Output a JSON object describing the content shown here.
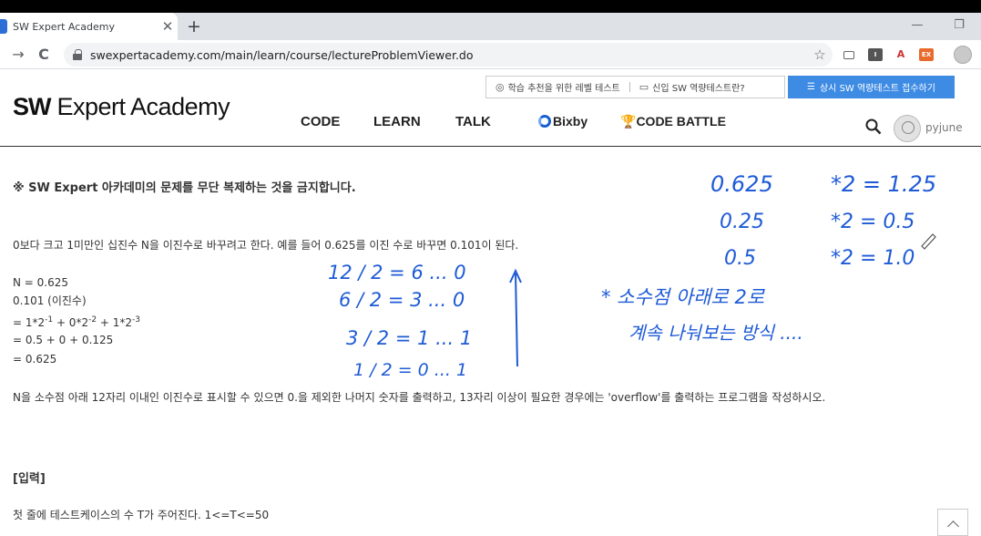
{
  "browser": {
    "tab_title": "SW Expert Academy",
    "tab_close": "✕",
    "new_tab": "+",
    "url": "swexpertacademy.com/main/learn/course/lectureProblemViewer.do",
    "minimize": "—",
    "restore": "❐",
    "back_icon": "→",
    "reload_icon": "C",
    "star_icon": "☆",
    "ext_pdf": "A",
    "ext_ex": "EX",
    "ext_i": "I"
  },
  "header": {
    "logo_bold": "SW",
    "logo_rest": " Expert Academy",
    "links": [
      {
        "label": "학습 추천을 위한 레벨 테스트",
        "icon": "check-circle-icon"
      },
      {
        "label": "신입 SW 역량테스트란?",
        "icon": "laptop-icon"
      }
    ],
    "apply_label": "상시 SW 역량테스트 접수하기",
    "menu": [
      "CODE",
      "LEARN",
      "TALK"
    ],
    "bixby": "Bixby",
    "code_battle": "CODE BATTLE",
    "username": "pyjune"
  },
  "content": {
    "notice": "※ SW Expert 아카데미의 문제를 무단 복제하는 것을 금지합니다.",
    "intro": "0보다 크고 1미만인 십진수 N을 이진수로 바꾸려고 한다. 예를 들어 0.625를 이진 수로 바꾸면 0.101이 된다.",
    "math": {
      "line1": "N = 0.625",
      "line2": "0.101 (이진수)",
      "line3_a": "= 1*2",
      "line3_e1": "-1",
      "line3_b": " + 0*2",
      "line3_e2": "-2",
      "line3_c": " + 1*2",
      "line3_e3": "-3",
      "line4": "= 0.5 + 0 + 0.125",
      "line5": "= 0.625"
    },
    "task": "N을 소수점 아래 12자리 이내인 이진수로 표시할 수 있으면 0.을 제외한 나머지 숫자를 출력하고, 13자리 이상이 필요한 경우에는 'overflow'를 출력하는 프로그램을 작성하시오.",
    "input_heading": "[입력]",
    "input_text": "첫 줄에 테스트케이스의 수 T가 주어진다. 1<=T<=50"
  },
  "handwriting": {
    "color": "#1f5bd6",
    "right_rows": [
      {
        "a": "0.625",
        "b": "*2 = 1.25"
      },
      {
        "a": "0.25",
        "b": "*2 = 0.5"
      },
      {
        "a": "0.5",
        "b": "*2 = 1.0"
      }
    ],
    "division_rows": [
      "12 / 2 = 6 ... 0",
      "6 / 2 = 3 ... 0",
      "3 / 2 = 1 ... 1",
      "1 / 2 = 0 ... 1"
    ],
    "note_line1": "* 소수점 아래로 2로",
    "note_line2": "계속 나눠보는 방식 ...."
  },
  "colors": {
    "accent_blue": "#3e8be4",
    "tab_bg": "#dee1e6"
  }
}
